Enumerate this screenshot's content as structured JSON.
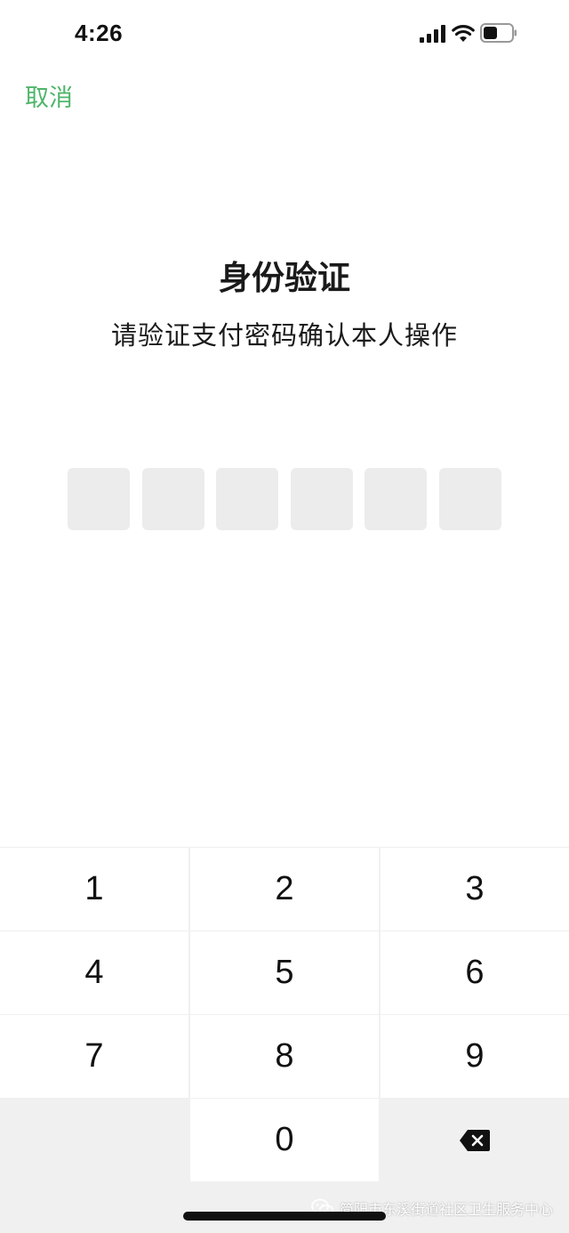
{
  "status_bar": {
    "time": "4:26",
    "icons": [
      "cellular-signal-icon",
      "wifi-icon",
      "battery-icon"
    ]
  },
  "header": {
    "cancel_label": "取消"
  },
  "main": {
    "title": "身份验证",
    "subtitle": "请验证支付密码确认本人操作",
    "pin_length": 6,
    "pin_filled": 0
  },
  "keypad": {
    "keys": [
      "1",
      "2",
      "3",
      "4",
      "5",
      "6",
      "7",
      "8",
      "9",
      "",
      "0",
      "backspace-icon"
    ]
  },
  "watermark": {
    "text": "简阳市东溪街道社区卫生服务中心",
    "icon": "wechat-icon"
  },
  "colors": {
    "accent": "#4fb56b",
    "pin_box": "#ececec",
    "keypad_bg": "#f0f0f0"
  }
}
